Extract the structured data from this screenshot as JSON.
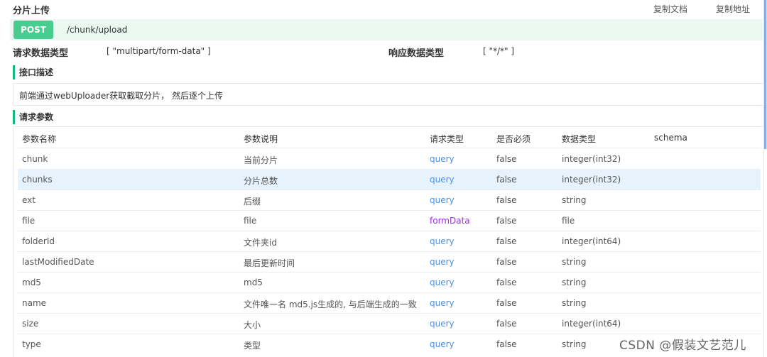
{
  "header": {
    "title": "分片上传",
    "copy_doc": "复制文档",
    "copy_url": "复制地址"
  },
  "method": "POST",
  "endpoint": "/chunk/upload",
  "request_type": {
    "label": "请求数据类型",
    "value": "[ \"multipart/form-data\" ]"
  },
  "response_type": {
    "label": "响应数据类型",
    "value": "[ \"*/*\" ]"
  },
  "description": {
    "heading": "接口描述",
    "text": "前端通过webUploader获取截取分片， 然后逐个上传"
  },
  "params": {
    "heading": "请求参数",
    "columns": [
      "参数名称",
      "参数说明",
      "请求类型",
      "是否必须",
      "数据类型",
      "schema"
    ],
    "rows": [
      {
        "name": "chunk",
        "desc": "当前分片",
        "in": "query",
        "required": "false",
        "type": "integer(int32)",
        "schema": ""
      },
      {
        "name": "chunks",
        "desc": "分片总数",
        "in": "query",
        "required": "false",
        "type": "integer(int32)",
        "schema": ""
      },
      {
        "name": "ext",
        "desc": "后缀",
        "in": "query",
        "required": "false",
        "type": "string",
        "schema": ""
      },
      {
        "name": "file",
        "desc": "file",
        "in": "formData",
        "required": "false",
        "type": "file",
        "schema": ""
      },
      {
        "name": "folderId",
        "desc": "文件夹id",
        "in": "query",
        "required": "false",
        "type": "integer(int64)",
        "schema": ""
      },
      {
        "name": "lastModifiedDate",
        "desc": "最后更新时间",
        "in": "query",
        "required": "false",
        "type": "string",
        "schema": ""
      },
      {
        "name": "md5",
        "desc": "md5",
        "in": "query",
        "required": "false",
        "type": "string",
        "schema": ""
      },
      {
        "name": "name",
        "desc": "文件唯一名 md5.js生成的, 与后端生成的一致",
        "in": "query",
        "required": "false",
        "type": "string",
        "schema": ""
      },
      {
        "name": "size",
        "desc": "大小",
        "in": "query",
        "required": "false",
        "type": "integer(int64)",
        "schema": ""
      },
      {
        "name": "type",
        "desc": "类型",
        "in": "query",
        "required": "false",
        "type": "string",
        "schema": ""
      }
    ]
  },
  "watermark": "CSDN @假装文艺范儿",
  "colors": {
    "post_badge": "#49cc90",
    "accent": "#10b87b",
    "link": "#4a90e2",
    "formdata": "#9b30d9",
    "row_highlight": "#e6f3fc"
  }
}
